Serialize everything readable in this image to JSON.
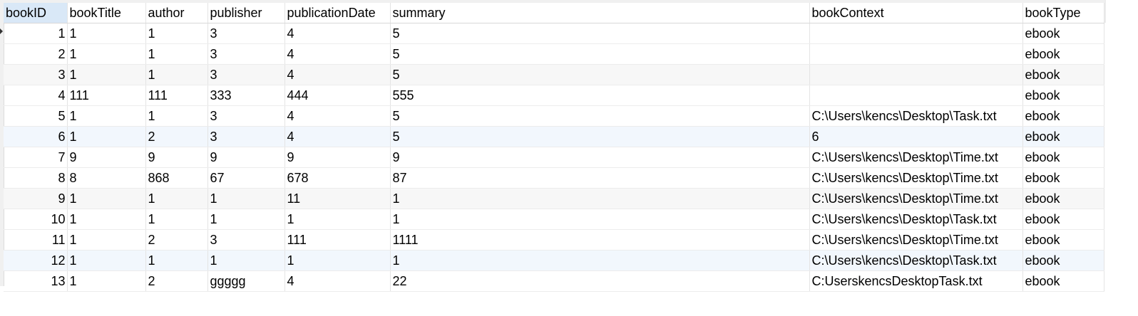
{
  "grid": {
    "columns": [
      "bookID",
      "bookTitle",
      "author",
      "publisher",
      "publicationDate",
      "summary",
      "bookContext",
      "bookType"
    ],
    "rows": [
      [
        "1",
        "1",
        "1",
        "3",
        "4",
        "5",
        "",
        "ebook"
      ],
      [
        "2",
        "1",
        "1",
        "3",
        "4",
        "5",
        "",
        "ebook"
      ],
      [
        "3",
        "1",
        "1",
        "3",
        "4",
        "5",
        "",
        "ebook"
      ],
      [
        "4",
        "111",
        "111",
        "333",
        "444",
        "555",
        "",
        "ebook"
      ],
      [
        "5",
        "1",
        "1",
        "3",
        "4",
        "5",
        "C:\\Users\\kencs\\Desktop\\Task.txt",
        "ebook"
      ],
      [
        "6",
        "1",
        "2",
        "3",
        "4",
        "5",
        "6",
        "ebook"
      ],
      [
        "7",
        "9",
        "9",
        "9",
        "9",
        "9",
        "C:\\Users\\kencs\\Desktop\\Time.txt",
        "ebook"
      ],
      [
        "8",
        "8",
        "868",
        "67",
        "678",
        "87",
        "C:\\Users\\kencs\\Desktop\\Time.txt",
        "ebook"
      ],
      [
        "9",
        "1",
        "1",
        "1",
        "11",
        "1",
        "C:\\Users\\kencs\\Desktop\\Time.txt",
        "ebook"
      ],
      [
        "10",
        "1",
        "1",
        "1",
        "1",
        "1",
        "C:\\Users\\kencs\\Desktop\\Task.txt",
        "ebook"
      ],
      [
        "11",
        "1",
        "2",
        "3",
        "111",
        "1111",
        "C:\\Users\\kencs\\Desktop\\Time.txt",
        "ebook"
      ],
      [
        "12",
        "1",
        "1",
        "1",
        "1",
        "1",
        "C:\\Users\\kencs\\Desktop\\Task.txt",
        "ebook"
      ],
      [
        "13",
        "1",
        "2",
        "ggggg",
        "4",
        "22",
        "C:UserskencsDesktopTask.txt",
        "ebook"
      ]
    ]
  },
  "colors": {
    "selected_header": "#d9e8f7",
    "alt_row": "#f7f7f7",
    "highlight_row": "#f2f7fd",
    "grid_line": "#e4e4e4"
  },
  "icons": {
    "current_row_marker": "triangle-right-icon"
  }
}
